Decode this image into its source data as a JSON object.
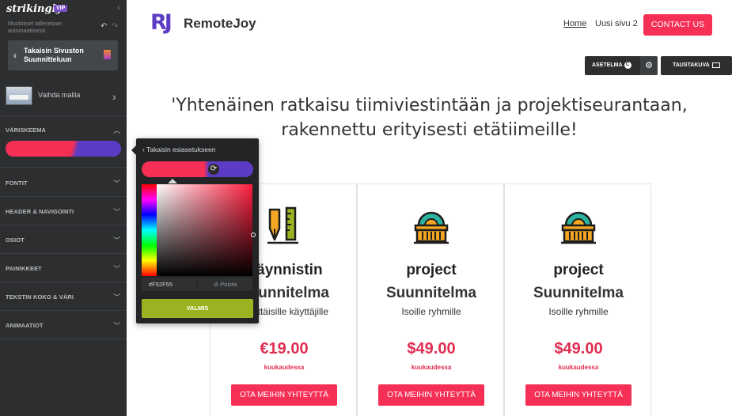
{
  "sidebar": {
    "brand": "strikingly",
    "badge": "VIP",
    "autosave": "Muutokset tallenetaan automaattisesti.",
    "back_label": "Takaisin Sivuston Suunnitteluun",
    "template_label": "Vaihda mallia",
    "sections": [
      {
        "label": "VÄRISKEEMA"
      },
      {
        "label": "FONTIT"
      },
      {
        "label": "HEADER & NAVIGOINTI"
      },
      {
        "label": "OSIOT"
      },
      {
        "label": "PAINIKKEET"
      },
      {
        "label": "TEKSTIN KOKO & VÄRI"
      },
      {
        "label": "ANIMAATIOT"
      }
    ]
  },
  "color_picker": {
    "back_label": "Takaisin esiasetukseen",
    "hex_value": "#F52F55",
    "clear_label": "Poista",
    "done_label": "VALMIS",
    "primary_color": "#F52F55",
    "secondary_color": "#5c3cc4"
  },
  "site": {
    "logo_mark": "RJ",
    "logo_text": "RemoteJoy",
    "nav": {
      "home": "Home",
      "page2": "Uusi sivu 2"
    },
    "contact_button": "CONTACT US"
  },
  "toolbar": {
    "settings_label": "ASETELMA",
    "settings_badge": "C",
    "background_label": "TAUSTAKUVA"
  },
  "headline": {
    "line1": "'Yhtenäinen ratkaisu tiimiviestintään ja projektiseurantaan,",
    "line2": "rakennettu erityisesti etätiimeille!"
  },
  "cards": [
    {
      "icon": "pen-ruler-icon",
      "title1": "Käynnistin",
      "title2": "Suunnitelma",
      "subtitle": "Yksittäisille käyttäjille",
      "price": "€19.00",
      "period": "kuukaudessa",
      "button": "OTA MEIHIN YHTEYTTÄ"
    },
    {
      "icon": "building-icon",
      "title1": "project",
      "title2": "Suunnitelma",
      "subtitle": "Isoille ryhmille",
      "price": "$49.00",
      "period": "kuukaudessa",
      "button": "OTA MEIHIN YHTEYTTÄ"
    },
    {
      "icon": "building-icon",
      "title1": "project",
      "title2": "Suunnitelma",
      "subtitle": "Isoille ryhmille",
      "price": "$49.00",
      "period": "kuukaudessa",
      "button": "OTA MEIHIN YHTEYTTÄ"
    }
  ]
}
